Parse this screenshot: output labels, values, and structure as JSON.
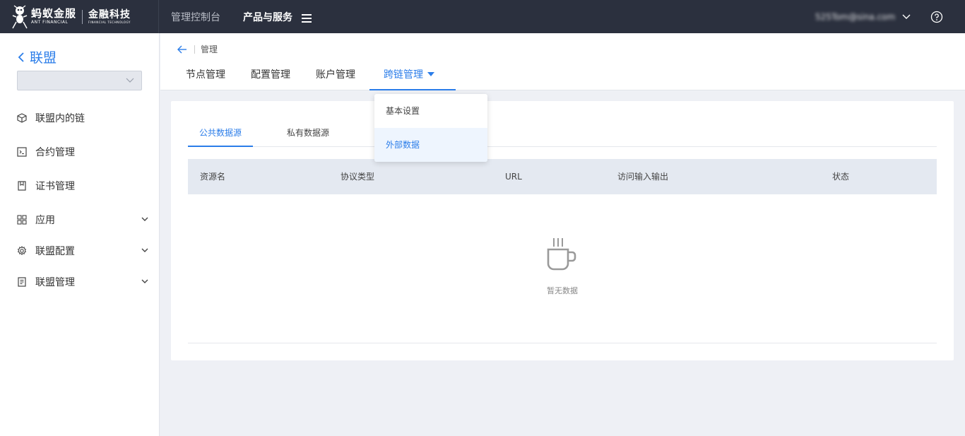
{
  "topbar": {
    "brand_cn": "蚂蚁金服",
    "brand_en": "ANT FINANCIAL",
    "brand_sub_cn": "金融科技",
    "brand_sub_en": "FINANCIAL TECHNOLOGY",
    "nav": [
      "管理控制台",
      "产品与服务"
    ],
    "user_email": "525Tom@sina.com"
  },
  "sidebar": {
    "title": "联盟",
    "select_value": "",
    "items": [
      {
        "label": "联盟内的链",
        "icon": "cube-icon"
      },
      {
        "label": "合约管理",
        "icon": "terminal-icon"
      },
      {
        "label": "证书管理",
        "icon": "bookmark-icon"
      },
      {
        "label": "应用",
        "icon": "grid-icon",
        "expandable": true
      },
      {
        "label": "联盟配置",
        "icon": "gear-icon",
        "expandable": true
      },
      {
        "label": "联盟管理",
        "icon": "document-icon",
        "expandable": true
      }
    ]
  },
  "main": {
    "breadcrumb": "管理",
    "tabs": [
      "节点管理",
      "配置管理",
      "账户管理",
      "跨链管理"
    ],
    "active_tab": "跨链管理",
    "dropdown": [
      "基本设置",
      "外部数据"
    ],
    "dropdown_selected": "外部数据",
    "subtabs": [
      "公共数据源",
      "私有数据源"
    ],
    "active_subtab": "公共数据源",
    "table_headers": [
      "资源名",
      "协议类型",
      "URL",
      "访问输入输出",
      "状态"
    ],
    "empty_text": "暂无数据"
  },
  "colors": {
    "topbar_bg": "#2b303e",
    "accent": "#2b7de9",
    "page_bg": "#eef0f5",
    "table_header_bg": "#e4e9f1"
  }
}
